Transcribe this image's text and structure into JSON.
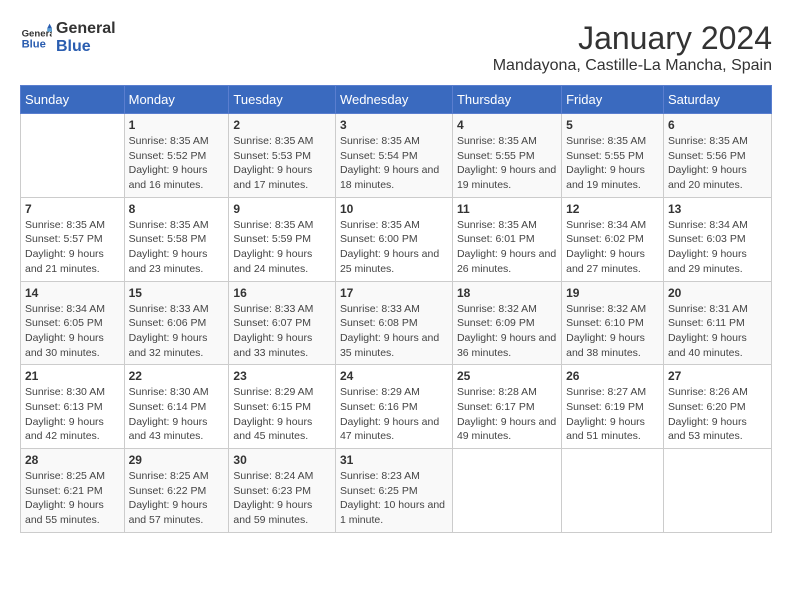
{
  "header": {
    "logo_line1": "General",
    "logo_line2": "Blue",
    "main_title": "January 2024",
    "subtitle": "Mandayona, Castille-La Mancha, Spain"
  },
  "weekdays": [
    "Sunday",
    "Monday",
    "Tuesday",
    "Wednesday",
    "Thursday",
    "Friday",
    "Saturday"
  ],
  "weeks": [
    [
      {
        "num": "",
        "sunrise": "",
        "sunset": "",
        "daylight": ""
      },
      {
        "num": "1",
        "sunrise": "Sunrise: 8:35 AM",
        "sunset": "Sunset: 5:52 PM",
        "daylight": "Daylight: 9 hours and 16 minutes."
      },
      {
        "num": "2",
        "sunrise": "Sunrise: 8:35 AM",
        "sunset": "Sunset: 5:53 PM",
        "daylight": "Daylight: 9 hours and 17 minutes."
      },
      {
        "num": "3",
        "sunrise": "Sunrise: 8:35 AM",
        "sunset": "Sunset: 5:54 PM",
        "daylight": "Daylight: 9 hours and 18 minutes."
      },
      {
        "num": "4",
        "sunrise": "Sunrise: 8:35 AM",
        "sunset": "Sunset: 5:55 PM",
        "daylight": "Daylight: 9 hours and 19 minutes."
      },
      {
        "num": "5",
        "sunrise": "Sunrise: 8:35 AM",
        "sunset": "Sunset: 5:55 PM",
        "daylight": "Daylight: 9 hours and 19 minutes."
      },
      {
        "num": "6",
        "sunrise": "Sunrise: 8:35 AM",
        "sunset": "Sunset: 5:56 PM",
        "daylight": "Daylight: 9 hours and 20 minutes."
      }
    ],
    [
      {
        "num": "7",
        "sunrise": "Sunrise: 8:35 AM",
        "sunset": "Sunset: 5:57 PM",
        "daylight": "Daylight: 9 hours and 21 minutes."
      },
      {
        "num": "8",
        "sunrise": "Sunrise: 8:35 AM",
        "sunset": "Sunset: 5:58 PM",
        "daylight": "Daylight: 9 hours and 23 minutes."
      },
      {
        "num": "9",
        "sunrise": "Sunrise: 8:35 AM",
        "sunset": "Sunset: 5:59 PM",
        "daylight": "Daylight: 9 hours and 24 minutes."
      },
      {
        "num": "10",
        "sunrise": "Sunrise: 8:35 AM",
        "sunset": "Sunset: 6:00 PM",
        "daylight": "Daylight: 9 hours and 25 minutes."
      },
      {
        "num": "11",
        "sunrise": "Sunrise: 8:35 AM",
        "sunset": "Sunset: 6:01 PM",
        "daylight": "Daylight: 9 hours and 26 minutes."
      },
      {
        "num": "12",
        "sunrise": "Sunrise: 8:34 AM",
        "sunset": "Sunset: 6:02 PM",
        "daylight": "Daylight: 9 hours and 27 minutes."
      },
      {
        "num": "13",
        "sunrise": "Sunrise: 8:34 AM",
        "sunset": "Sunset: 6:03 PM",
        "daylight": "Daylight: 9 hours and 29 minutes."
      }
    ],
    [
      {
        "num": "14",
        "sunrise": "Sunrise: 8:34 AM",
        "sunset": "Sunset: 6:05 PM",
        "daylight": "Daylight: 9 hours and 30 minutes."
      },
      {
        "num": "15",
        "sunrise": "Sunrise: 8:33 AM",
        "sunset": "Sunset: 6:06 PM",
        "daylight": "Daylight: 9 hours and 32 minutes."
      },
      {
        "num": "16",
        "sunrise": "Sunrise: 8:33 AM",
        "sunset": "Sunset: 6:07 PM",
        "daylight": "Daylight: 9 hours and 33 minutes."
      },
      {
        "num": "17",
        "sunrise": "Sunrise: 8:33 AM",
        "sunset": "Sunset: 6:08 PM",
        "daylight": "Daylight: 9 hours and 35 minutes."
      },
      {
        "num": "18",
        "sunrise": "Sunrise: 8:32 AM",
        "sunset": "Sunset: 6:09 PM",
        "daylight": "Daylight: 9 hours and 36 minutes."
      },
      {
        "num": "19",
        "sunrise": "Sunrise: 8:32 AM",
        "sunset": "Sunset: 6:10 PM",
        "daylight": "Daylight: 9 hours and 38 minutes."
      },
      {
        "num": "20",
        "sunrise": "Sunrise: 8:31 AM",
        "sunset": "Sunset: 6:11 PM",
        "daylight": "Daylight: 9 hours and 40 minutes."
      }
    ],
    [
      {
        "num": "21",
        "sunrise": "Sunrise: 8:30 AM",
        "sunset": "Sunset: 6:13 PM",
        "daylight": "Daylight: 9 hours and 42 minutes."
      },
      {
        "num": "22",
        "sunrise": "Sunrise: 8:30 AM",
        "sunset": "Sunset: 6:14 PM",
        "daylight": "Daylight: 9 hours and 43 minutes."
      },
      {
        "num": "23",
        "sunrise": "Sunrise: 8:29 AM",
        "sunset": "Sunset: 6:15 PM",
        "daylight": "Daylight: 9 hours and 45 minutes."
      },
      {
        "num": "24",
        "sunrise": "Sunrise: 8:29 AM",
        "sunset": "Sunset: 6:16 PM",
        "daylight": "Daylight: 9 hours and 47 minutes."
      },
      {
        "num": "25",
        "sunrise": "Sunrise: 8:28 AM",
        "sunset": "Sunset: 6:17 PM",
        "daylight": "Daylight: 9 hours and 49 minutes."
      },
      {
        "num": "26",
        "sunrise": "Sunrise: 8:27 AM",
        "sunset": "Sunset: 6:19 PM",
        "daylight": "Daylight: 9 hours and 51 minutes."
      },
      {
        "num": "27",
        "sunrise": "Sunrise: 8:26 AM",
        "sunset": "Sunset: 6:20 PM",
        "daylight": "Daylight: 9 hours and 53 minutes."
      }
    ],
    [
      {
        "num": "28",
        "sunrise": "Sunrise: 8:25 AM",
        "sunset": "Sunset: 6:21 PM",
        "daylight": "Daylight: 9 hours and 55 minutes."
      },
      {
        "num": "29",
        "sunrise": "Sunrise: 8:25 AM",
        "sunset": "Sunset: 6:22 PM",
        "daylight": "Daylight: 9 hours and 57 minutes."
      },
      {
        "num": "30",
        "sunrise": "Sunrise: 8:24 AM",
        "sunset": "Sunset: 6:23 PM",
        "daylight": "Daylight: 9 hours and 59 minutes."
      },
      {
        "num": "31",
        "sunrise": "Sunrise: 8:23 AM",
        "sunset": "Sunset: 6:25 PM",
        "daylight": "Daylight: 10 hours and 1 minute."
      },
      {
        "num": "",
        "sunrise": "",
        "sunset": "",
        "daylight": ""
      },
      {
        "num": "",
        "sunrise": "",
        "sunset": "",
        "daylight": ""
      },
      {
        "num": "",
        "sunrise": "",
        "sunset": "",
        "daylight": ""
      }
    ]
  ]
}
